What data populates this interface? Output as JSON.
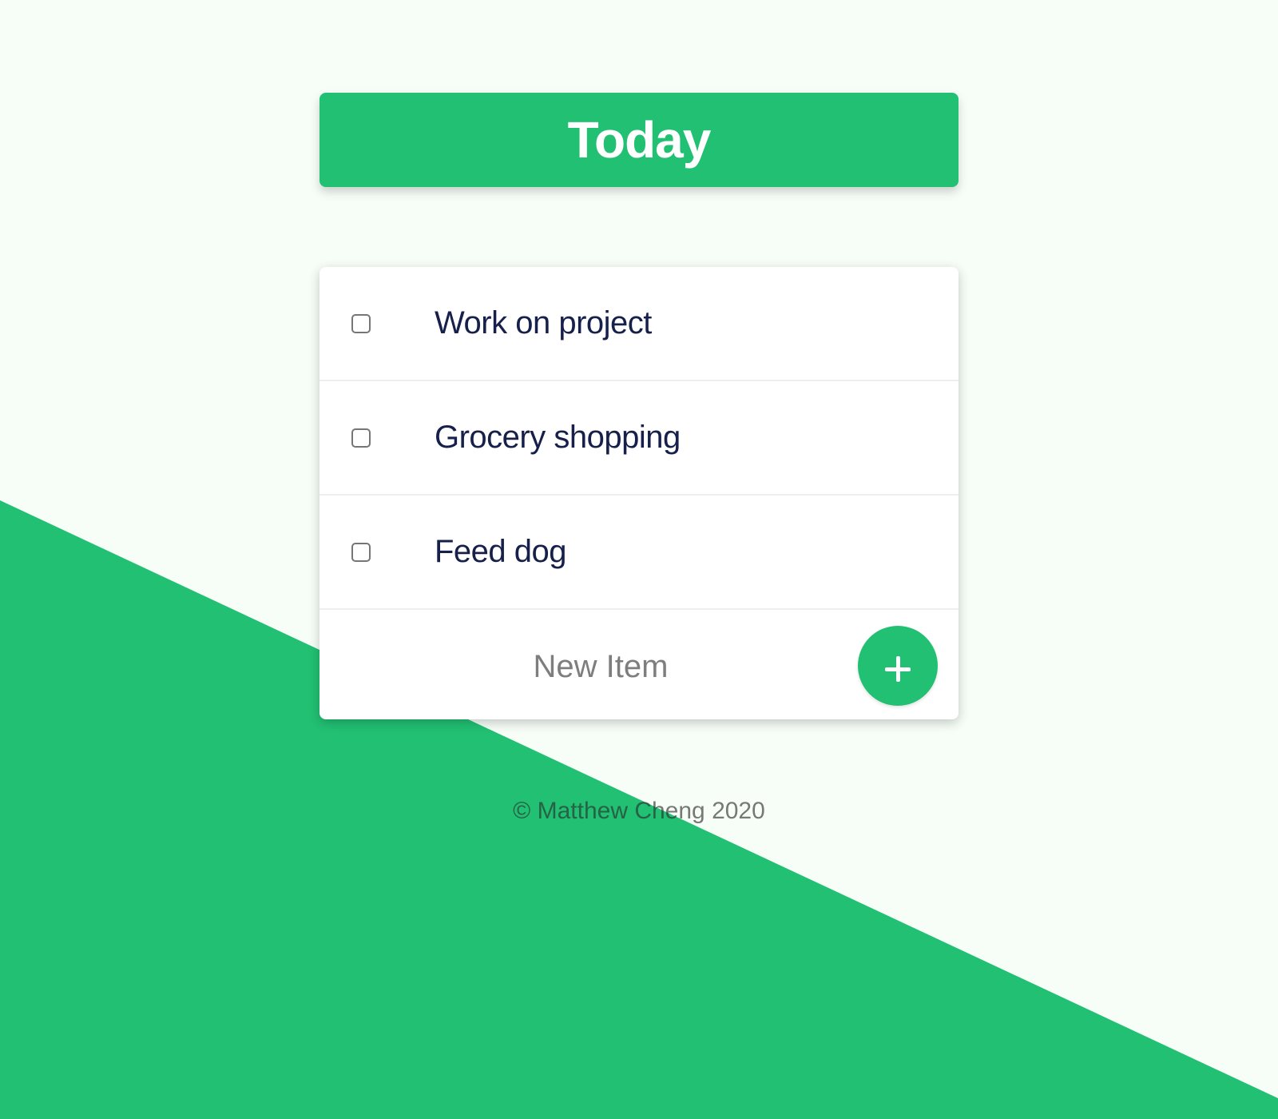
{
  "heading": {
    "title": "Today"
  },
  "list": {
    "items": [
      {
        "label": "Work on project",
        "checked": false
      },
      {
        "label": "Grocery shopping",
        "checked": false
      },
      {
        "label": "Feed dog",
        "checked": false
      }
    ]
  },
  "new_item": {
    "placeholder": "New Item",
    "add_label": "+"
  },
  "footer": {
    "text": "© Matthew Cheng 2020"
  },
  "colors": {
    "accent": "#22c073",
    "background": "#f7fdf7",
    "item_text": "#16204a"
  }
}
